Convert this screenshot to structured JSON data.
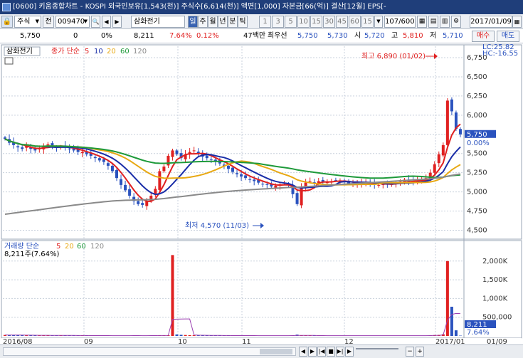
{
  "window": {
    "title": "[0600] 키움종합차트 - KOSPI 외국인보유[1,543(천)] 주식수[6,614(천)] 액면[1,000] 자본금[66(억)] 결산[12월] EPS[-"
  },
  "toolbar": {
    "market_select": "주식",
    "prev_label": "전",
    "code_value": "009470",
    "name_value": "삼화전기",
    "period_buttons": [
      "일",
      "주",
      "월",
      "년",
      "분",
      "틱"
    ],
    "minute_buttons": [
      "1",
      "3",
      "5",
      "10",
      "15",
      "30",
      "45",
      "60",
      "15"
    ],
    "count_value": "107",
    "count_total": "/600",
    "date_value": "2017/01/09"
  },
  "quote": {
    "price": "5,750",
    "change": "0",
    "change_rate": "0%",
    "volume": "8,211",
    "vol_rate": "7.64%",
    "turnover": "0.12%",
    "amount": "47백만",
    "hoga_label": "최우선",
    "ask": "5,750",
    "bid": "5,730",
    "open_label": "시",
    "open": "5,720",
    "high_label": "고",
    "high": "5,810",
    "low_label": "저",
    "low": "5,710",
    "buy_label": "매수",
    "sell_label": "매도"
  },
  "colors": {
    "up": "#e02020",
    "down": "#2a52be",
    "ma5": "#e02020",
    "ma10": "#1a2ea8",
    "ma20": "#e8a812",
    "ma60": "#1e9a3a",
    "ma120": "#8a8a8a",
    "vol_ma": "#9a3fb0"
  },
  "chart_data": {
    "type": "candlestick",
    "price_legend": {
      "name": "삼화전기",
      "label": "종가 단순",
      "periods": [
        "5",
        "10",
        "20",
        "60",
        "120"
      ]
    },
    "volume_legend": {
      "label": "거래량 단순",
      "periods": [
        "5",
        "20",
        "60",
        "120"
      ],
      "current": "8,211주(7.64%)"
    },
    "price_axis": {
      "ticks": [
        "6,750",
        "6,500",
        "6,250",
        "6,000",
        "5,750",
        "5,500",
        "5,250",
        "5,000",
        "4,750",
        "4,500"
      ],
      "range": [
        4430,
        6880
      ],
      "extra_labels": [
        "LC:25.82",
        "HC:-16.55"
      ],
      "current_label": "5,750",
      "current_pct": "0.00%"
    },
    "volume_axis": {
      "ticks": [
        "2,000K",
        "1,500K",
        "1,000K",
        "500,000"
      ],
      "range": [
        0,
        2300000
      ],
      "current_label": "8,211",
      "current_pct": "7.64%"
    },
    "x_labels": [
      "2016/08",
      "09",
      "10",
      "11",
      "12",
      "2017/01",
      "01/09"
    ],
    "annotations": {
      "high": "최고 6,890 (01/02)",
      "low": "최저 4,570 (11/03)"
    },
    "closes": [
      5690,
      5640,
      5610,
      5580,
      5560,
      5600,
      5560,
      5540,
      5570,
      5600,
      5620,
      5600,
      5580,
      5590,
      5580,
      5560,
      5540,
      5520,
      5520,
      5490,
      5470,
      5440,
      5410,
      5390,
      5340,
      5270,
      5180,
      5090,
      5020,
      4950,
      4880,
      4840,
      4830,
      4880,
      4950,
      5040,
      5270,
      5330,
      5470,
      5540,
      5490,
      5440,
      5490,
      5520,
      5540,
      5500,
      5460,
      5440,
      5420,
      5400,
      5370,
      5340,
      5300,
      5260,
      5230,
      5200,
      5180,
      5160,
      5140,
      5120,
      5100,
      5090,
      5070,
      5080,
      5100,
      5120,
      5090,
      4970,
      4840,
      5060,
      5120,
      5140,
      5110,
      5140,
      5130,
      5130,
      5140,
      5150,
      5150,
      5130,
      5110,
      5100,
      5100,
      5120,
      5120,
      5110,
      5100,
      5090,
      5100,
      5110,
      5100,
      5120,
      5140,
      5160,
      5130,
      5140,
      5150,
      5160,
      5180,
      5250,
      5360,
      5490,
      5610,
      6190,
      6050,
      5820,
      5750
    ],
    "volumes": [
      26000,
      24000,
      22000,
      21000,
      20000,
      19000,
      18000,
      17000,
      16000,
      16000,
      15000,
      14000,
      14000,
      13000,
      12000,
      12000,
      11000,
      11000,
      10000,
      10000,
      9000,
      9000,
      9000,
      8000,
      8000,
      8000,
      8000,
      9000,
      9000,
      8000,
      9000,
      8000,
      8000,
      9000,
      10000,
      12000,
      14000,
      15000,
      18000,
      2160000,
      40000,
      30000,
      25000,
      20000,
      18000,
      16000,
      15000,
      14000,
      13000,
      12000,
      11000,
      10000,
      10000,
      9000,
      9000,
      9000,
      9000,
      8000,
      8000,
      8000,
      8000,
      9000,
      8000,
      8000,
      8000,
      9000,
      9000,
      9000,
      35000,
      12000,
      10000,
      9000,
      9000,
      8000,
      8000,
      8000,
      8000,
      8000,
      8000,
      8000,
      8000,
      8000,
      8000,
      8000,
      8000,
      8000,
      8000,
      8000,
      8000,
      8000,
      8000,
      8000,
      8000,
      8000,
      8000,
      8000,
      8000,
      8000,
      9000,
      15000,
      22000,
      28000,
      45000,
      2000000,
      780000,
      150000,
      8211
    ]
  },
  "statusbar": {
    "buttons": [
      "◀",
      "▶",
      "|◀",
      "■",
      "▶|",
      "▶"
    ]
  }
}
